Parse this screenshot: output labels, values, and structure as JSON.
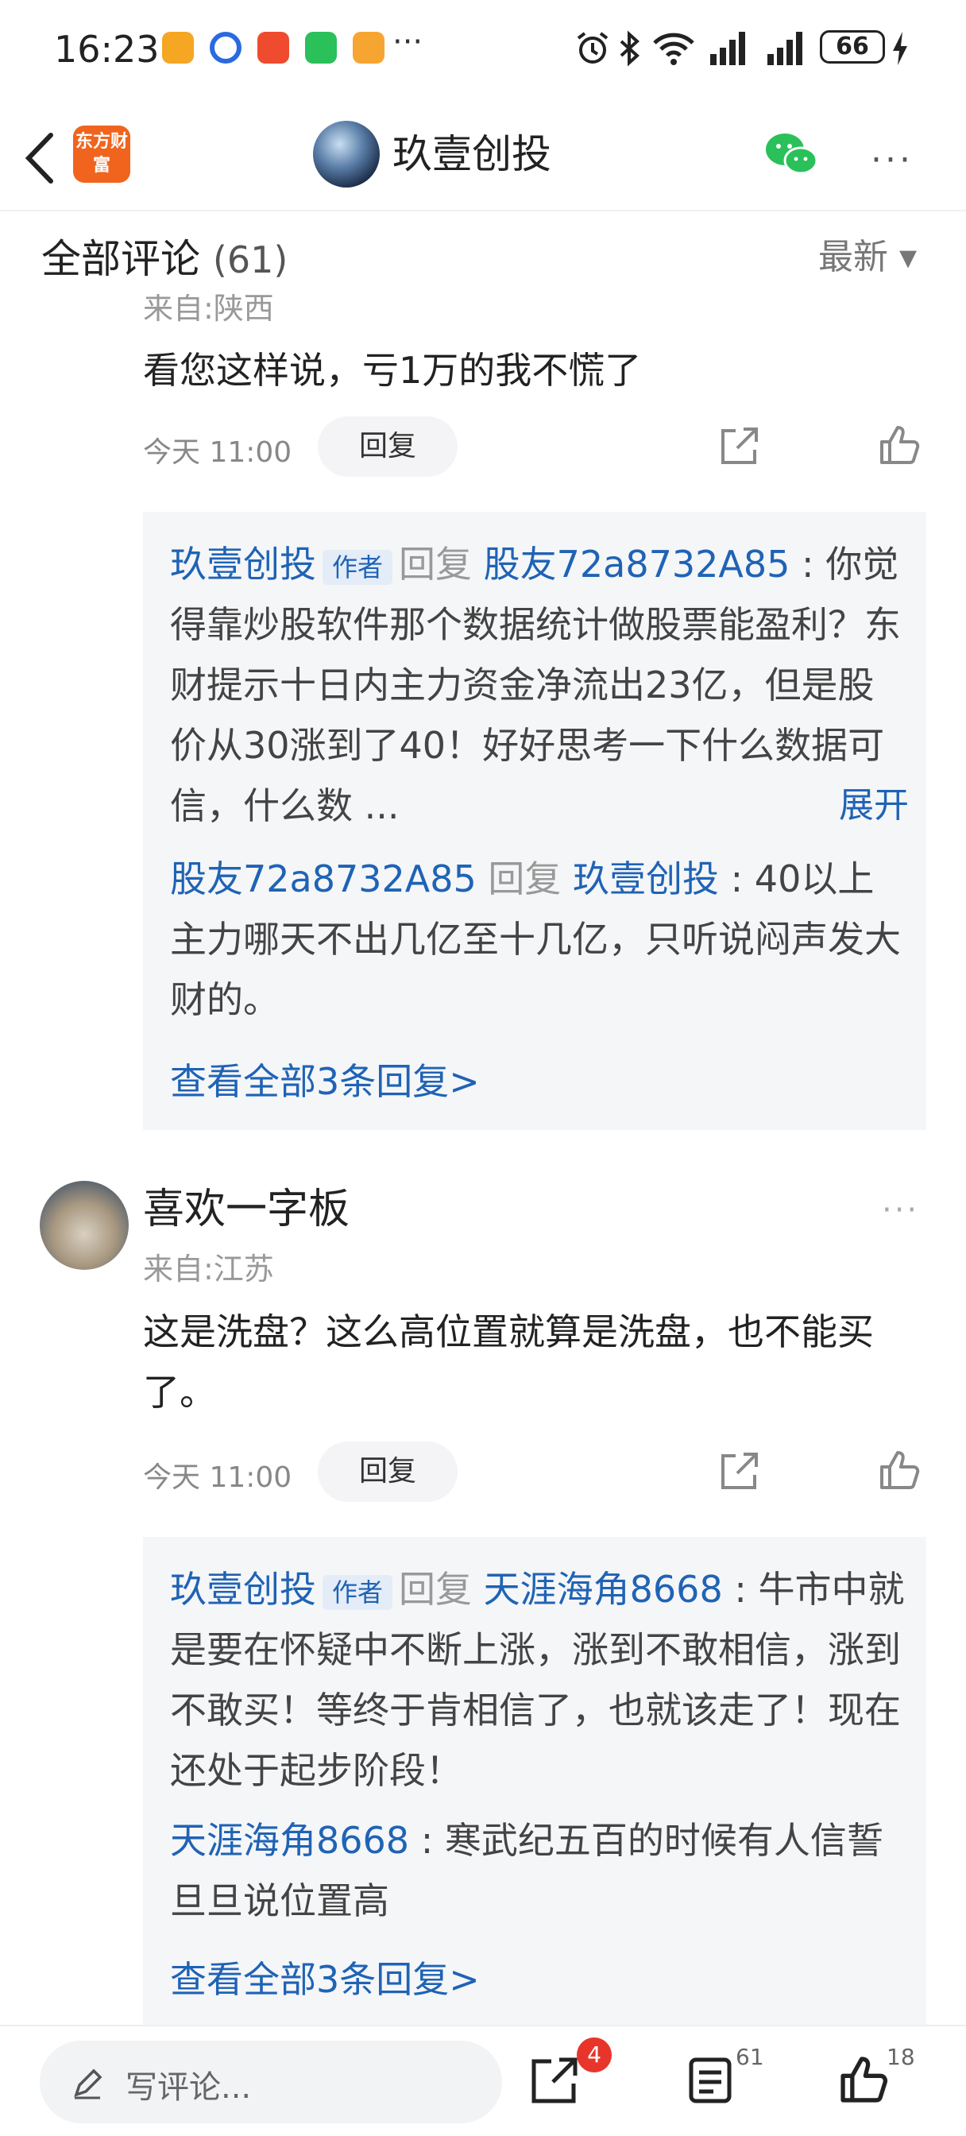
{
  "status_bar": {
    "time": "16:23",
    "more": "···",
    "battery": "66"
  },
  "header": {
    "logo_text": "东方财富",
    "title": "玖壹创投",
    "more": "···"
  },
  "section": {
    "title": "全部评论",
    "count": "(61)",
    "sort": "最新 ▾"
  },
  "cutoff_text": "来自:陕西",
  "comment1": {
    "text": "看您这样说，亏1万的我不慌了",
    "time": "今天 11:00",
    "reply_label": "回复",
    "replies": [
      {
        "user": "玖壹创投",
        "tag": "作者",
        "verb": "回复",
        "target": "股友72a8732A85",
        "text": "你觉得靠炒股软件那个数据统计做股票能盈利？东财提示十日内主力资金净流出23亿，但是股价从30涨到了40！好好思考一下什么数据可信，什么数 ...",
        "expand": "展开"
      },
      {
        "user": "股友72a8732A85",
        "verb": "回复",
        "target": "玖壹创投",
        "text": "40以上主力哪天不出几亿至十几亿，只听说闷声发大财的。"
      }
    ],
    "view_all": "查看全部3条回复>"
  },
  "comment2": {
    "user": "喜欢一字板",
    "location": "来自:江苏",
    "text": "这是洗盘？这么高位置就算是洗盘，也不能买了。",
    "time": "今天 11:00",
    "reply_label": "回复",
    "more": "···",
    "replies": [
      {
        "user": "玖壹创投",
        "tag": "作者",
        "verb": "回复",
        "target": "天涯海角8668",
        "text": "牛市中就是要在怀疑中不断上涨，涨到不敢相信，涨到不敢买！等终于肯相信了，也就该走了！现在还处于起步阶段！"
      },
      {
        "user": "天涯海角8668",
        "text": "寒武纪五百的时候有人信誓旦旦说位置高"
      }
    ],
    "view_all": "查看全部3条回复>"
  },
  "bottom_bar": {
    "placeholder": "写评论...",
    "share_badge": "4",
    "comments_count": "61",
    "likes_count": "18"
  },
  "colors": {
    "accent_blue": "#1f63b5",
    "brand_orange": "#f0641e",
    "badge_red": "#e8352b"
  }
}
